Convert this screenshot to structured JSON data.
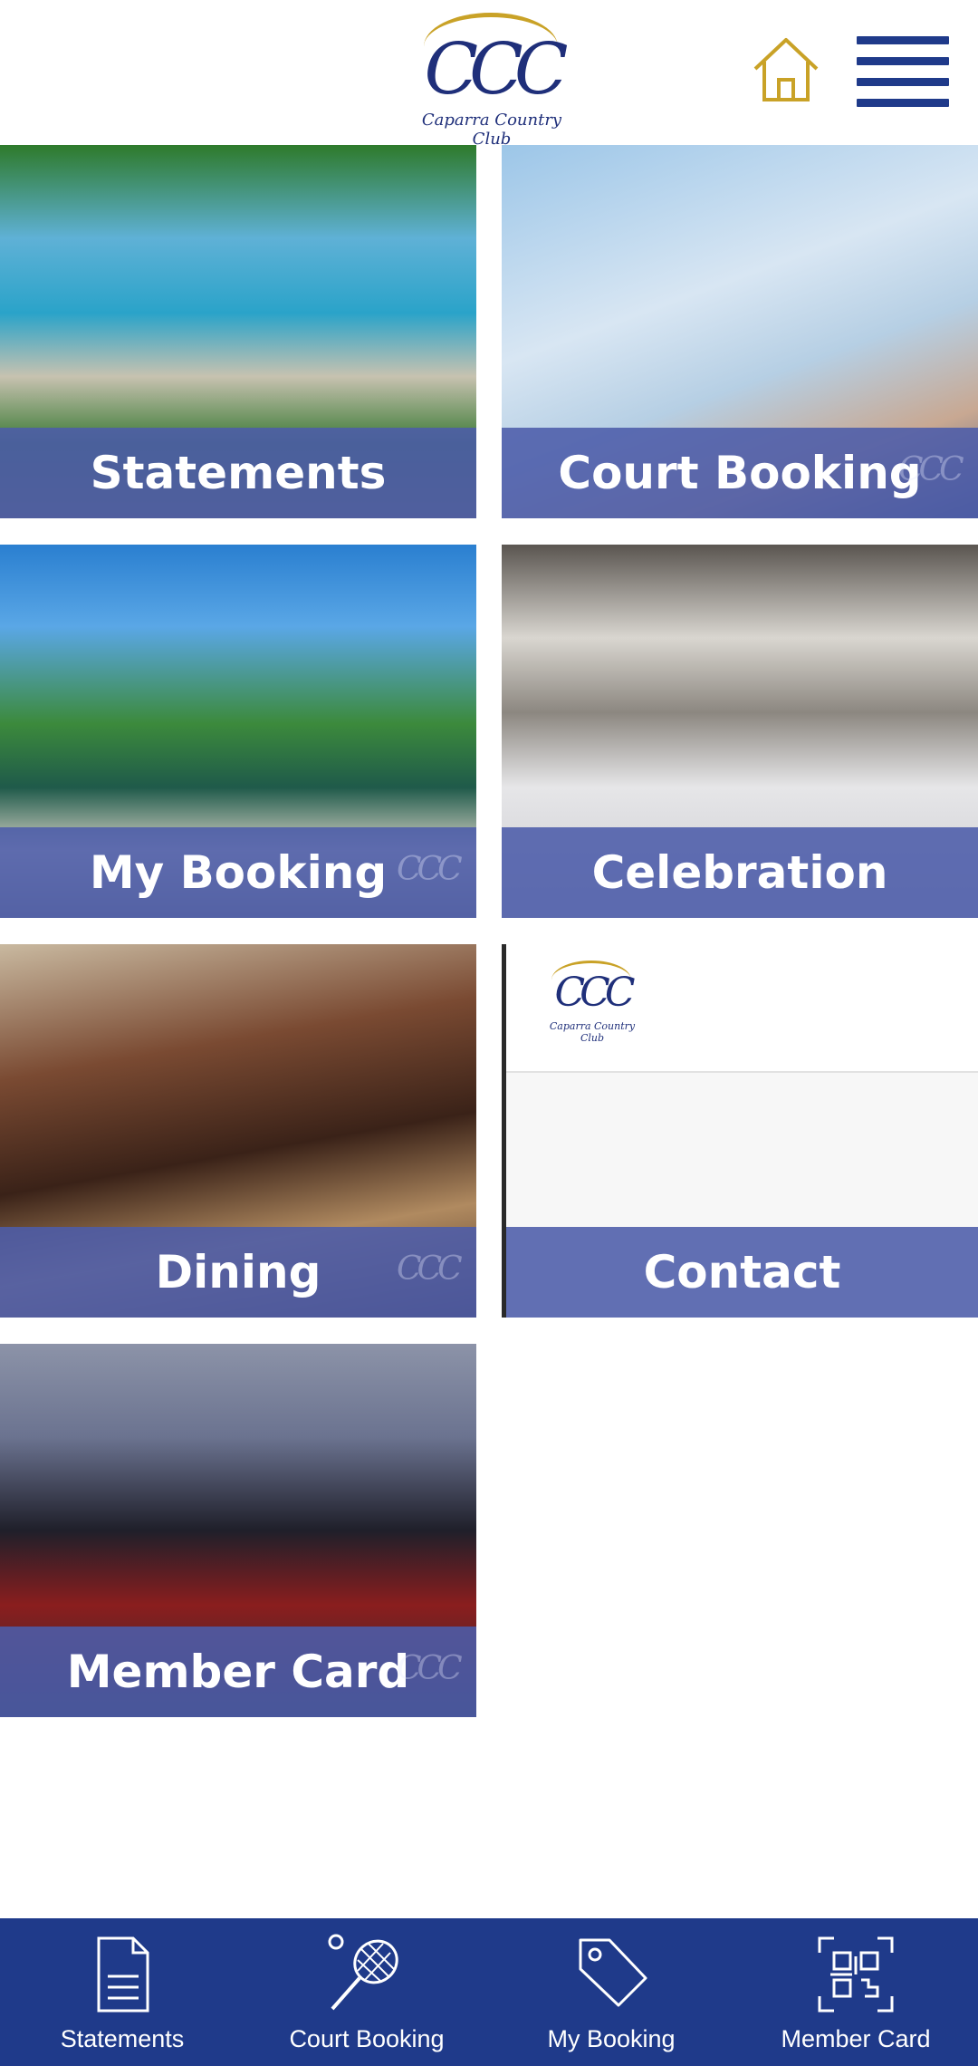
{
  "header": {
    "logo_letters": "CCC",
    "logo_text": "Caparra Country Club",
    "home_icon": "home-icon",
    "menu_icon": "hamburger-menu-icon"
  },
  "tiles": [
    {
      "label": "Statements"
    },
    {
      "label": "Court Booking"
    },
    {
      "label": "My Booking"
    },
    {
      "label": "Celebration"
    },
    {
      "label": "Dining"
    },
    {
      "label": "Contact"
    },
    {
      "label": "Member Card"
    }
  ],
  "bottom_nav": [
    {
      "label": "Statements",
      "icon": "document-icon"
    },
    {
      "label": "Court Booking",
      "icon": "racket-icon"
    },
    {
      "label": "My Booking",
      "icon": "tag-icon"
    },
    {
      "label": "Member Card",
      "icon": "qr-code-icon"
    }
  ],
  "colors": {
    "primary": "#1f3a8a",
    "accent_gold": "#c9a227",
    "label_bar": "#4c5caa"
  }
}
